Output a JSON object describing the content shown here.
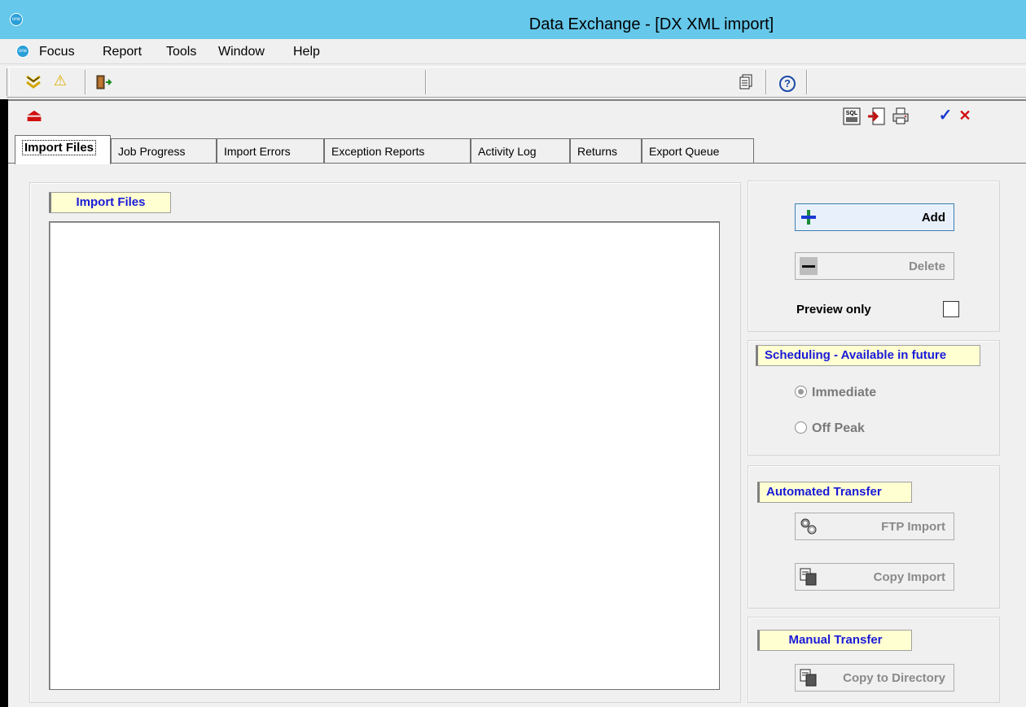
{
  "window": {
    "title": "Data Exchange - [DX XML import]",
    "logo_text": "one"
  },
  "menu": {
    "items": [
      "Focus",
      "Report",
      "Tools",
      "Window",
      "Help"
    ]
  },
  "toolbar": {
    "icons": [
      "download-arrow-icon",
      "warning-icon",
      "exit-door-icon",
      "copy-pages-icon",
      "help-icon"
    ],
    "warning_glyph": "⚠",
    "help_glyph": "?"
  },
  "form_toolbar": {
    "icons": [
      "eject-icon",
      "sql-icon",
      "import-icon",
      "print-icon",
      "confirm-check-icon",
      "cancel-x-icon"
    ],
    "sql_text": "SQL",
    "confirm_glyph": "✓",
    "cancel_glyph": "✕",
    "eject_glyph": "⏏"
  },
  "tabs": [
    {
      "label": "Import Files",
      "active": true
    },
    {
      "label": "Job Progress",
      "active": false
    },
    {
      "label": "Import Errors",
      "active": false
    },
    {
      "label": "Exception Reports",
      "active": false
    },
    {
      "label": "Activity Log",
      "active": false
    },
    {
      "label": "Returns",
      "active": false
    },
    {
      "label": "Export Queue",
      "active": false
    }
  ],
  "import_files": {
    "group_label": "Import Files"
  },
  "actions": {
    "add_label": "Add",
    "delete_label": "Delete",
    "preview_label": "Preview only",
    "preview_checked": false
  },
  "scheduling": {
    "group_label": "Scheduling - Available in future",
    "options": [
      {
        "label": "Immediate",
        "checked": true
      },
      {
        "label": "Off Peak",
        "checked": false
      }
    ]
  },
  "automated_transfer": {
    "group_label": "Automated Transfer",
    "ftp_label": "FTP Import",
    "copy_label": "Copy Import"
  },
  "manual_transfer": {
    "group_label": "Manual Transfer",
    "copy_dir_label": "Copy to Directory"
  },
  "colors": {
    "titlebar": "#66c8ea",
    "group_label_bg": "#ffffd2",
    "group_label_text": "#1a1ad8",
    "disabled_text": "#8a8a8a"
  }
}
